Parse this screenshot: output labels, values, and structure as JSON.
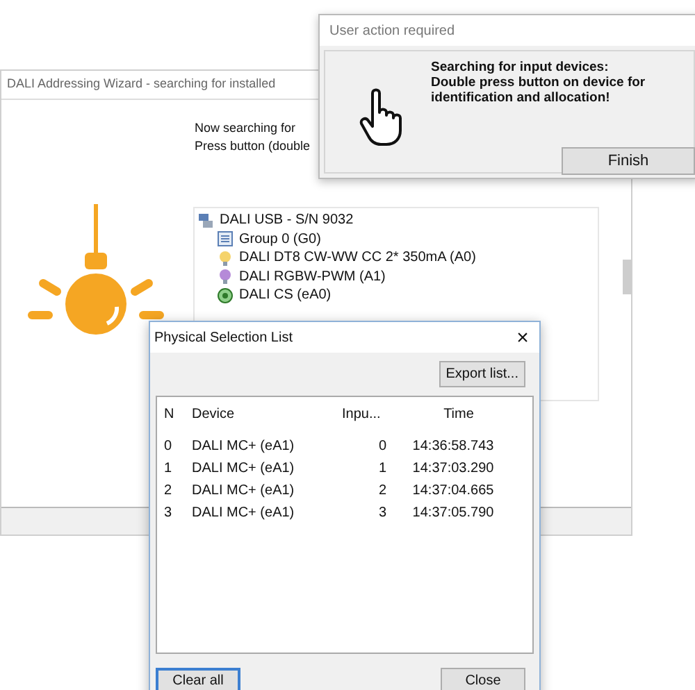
{
  "wizard_window": {
    "title": "DALI Addressing Wizard - searching for installed",
    "message_lines": [
      "Now searching for",
      "Press button (double"
    ],
    "tree": {
      "label": "DALI USB - S/N 9032",
      "kind": "usb",
      "children": [
        {
          "label": "Group 0 (G0)",
          "kind": "group"
        },
        {
          "label": "DALI DT8 CW-WW CC 2* 350mA (A0)",
          "kind": "lamp"
        },
        {
          "label": "DALI RGBW-PWM (A1)",
          "kind": "rgb-lamp"
        },
        {
          "label": "DALI CS (eA0)",
          "kind": "sensor"
        }
      ]
    }
  },
  "user_action_dialog": {
    "title": "User action required",
    "message_lines": [
      "Searching for input devices:",
      "Double press button on device for",
      "identification and allocation!"
    ],
    "button": "Finish"
  },
  "physical_selection_list": {
    "title": "Physical Selection List",
    "close_glyph": "×",
    "export_button": "Export list...",
    "columns": [
      "N",
      "Device",
      "Inpu...",
      "Time"
    ],
    "rows": [
      {
        "n": "0",
        "device": "DALI MC+ (eA1)",
        "input": "0",
        "time": "14:36:58.743"
      },
      {
        "n": "1",
        "device": "DALI MC+ (eA1)",
        "input": "1",
        "time": "14:37:03.290"
      },
      {
        "n": "2",
        "device": "DALI MC+ (eA1)",
        "input": "2",
        "time": "14:37:04.665"
      },
      {
        "n": "3",
        "device": "DALI MC+ (eA1)",
        "input": "3",
        "time": "14:37:05.790"
      }
    ],
    "buttons": [
      {
        "label": "Clear all",
        "focused": true
      },
      {
        "label": "Close",
        "focused": false
      }
    ]
  }
}
